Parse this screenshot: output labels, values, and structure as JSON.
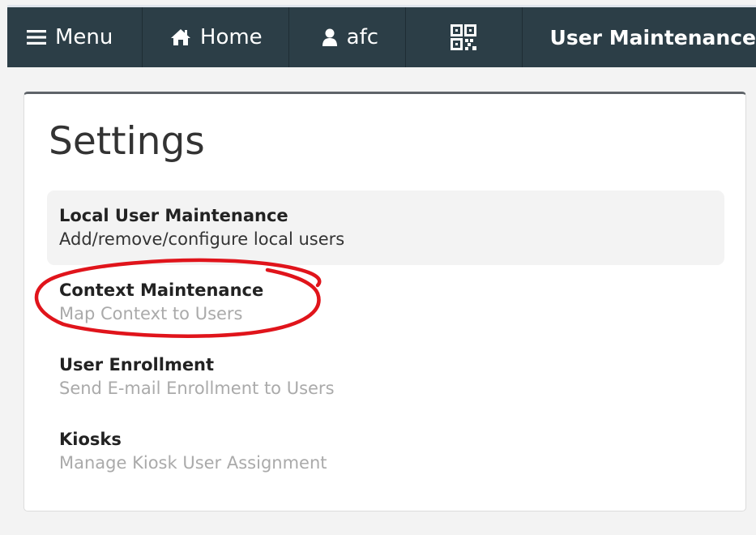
{
  "navbar": {
    "menu_label": "Menu",
    "home_label": "Home",
    "user_label": "afc",
    "page_title": "User Maintenance",
    "menu_icon": "hamburger-icon",
    "home_icon": "home-icon",
    "user_icon": "user-icon",
    "qr_icon": "qr-code-icon",
    "background_color": "#2c3e47"
  },
  "settings": {
    "title": "Settings",
    "items": [
      {
        "title": "Local User Maintenance",
        "description": "Add/remove/configure local users"
      },
      {
        "title": "Context Maintenance",
        "description": "Map Context to Users"
      },
      {
        "title": "User Enrollment",
        "description": "Send E-mail Enrollment to Users"
      },
      {
        "title": "Kiosks",
        "description": "Manage Kiosk User Assignment"
      }
    ]
  },
  "annotation": {
    "shape": "ellipse",
    "color": "#e0141b",
    "target": "Context Maintenance"
  }
}
